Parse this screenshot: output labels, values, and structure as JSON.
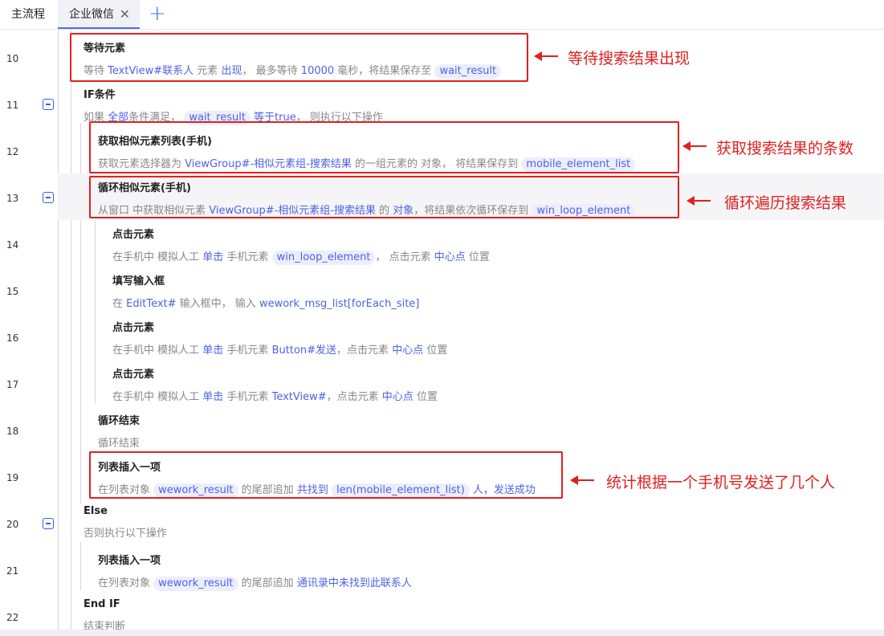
{
  "tabs": {
    "main": "主流程",
    "active": "企业微信",
    "close_icon": "close-icon",
    "add_icon": "plus-icon"
  },
  "lines": {
    "l10": "10",
    "l11": "11",
    "l12": "12",
    "l13": "13",
    "l14": "14",
    "l15": "15",
    "l16": "16",
    "l17": "17",
    "l18": "18",
    "l19": "19",
    "l20": "20",
    "l21": "21",
    "l22": "22"
  },
  "steps": {
    "s10": {
      "title": "等待元素",
      "d1": "等待",
      "d2": "TextView#联系人",
      "d3": "元素",
      "d4": "出现",
      "d5": "，  最多等待",
      "d6": "10000",
      "d7": "毫秒，将结果保存至",
      "d8": "wait_result"
    },
    "s11": {
      "title": "IF条件",
      "d1": "如果",
      "d2": "全部",
      "d3": "条件满足，",
      "d4": "wait_result",
      "d5": "等于true",
      "d6": "，  则执行以下操作"
    },
    "s12": {
      "title": "获取相似元素列表(手机)",
      "d1": "获取元素选择器为",
      "d2": "ViewGroup#-相似元素组-搜索结果",
      "d3": "的一组元素的 对象，  将结果保存到",
      "d4": "mobile_element_list"
    },
    "s13": {
      "title": "循环相似元素(手机)",
      "d1": "从窗口 中获取相似元素",
      "d2": "ViewGroup#-相似元素组-搜索结果",
      "d3": "的",
      "d4": "对象",
      "d5": "，将结果依次循环保存到",
      "d6": "win_loop_element"
    },
    "s14": {
      "title": "点击元素",
      "d1": "在手机中 模拟人工",
      "d2": "单击",
      "d3": "手机元素",
      "d4": "win_loop_element",
      "d5": "，  点击元素",
      "d6": "中心点",
      "d7": "位置"
    },
    "s15": {
      "title": "填写输入框",
      "d1": "在",
      "d2": "EditText#",
      "d3": "输入框中，  输入",
      "d4": "wework_msg_list[forEach_site]"
    },
    "s16": {
      "title": "点击元素",
      "d1": "在手机中 模拟人工",
      "d2": "单击",
      "d3": "手机元素",
      "d4": "Button#发送",
      "d5": "，点击元素",
      "d6": "中心点",
      "d7": "位置"
    },
    "s17": {
      "title": "点击元素",
      "d1": "在手机中 模拟人工",
      "d2": "单击",
      "d3": "手机元素",
      "d4": "TextView#",
      "d5": "，点击元素",
      "d6": "中心点",
      "d7": "位置"
    },
    "s18": {
      "title": "循环结束",
      "d1": "循环结束"
    },
    "s19": {
      "title": "列表插入一项",
      "d1": "在列表对象",
      "d2": "wework_result",
      "d3": "的尾部追加",
      "d4": "共找到",
      "d5": "len(mobile_element_list)",
      "d6": "人，发送成功"
    },
    "s20": {
      "title": "Else",
      "d1": "否则执行以下操作"
    },
    "s21": {
      "title": "列表插入一项",
      "d1": "在列表对象",
      "d2": "wework_result",
      "d3": "的尾部追加",
      "d4": "通讯录中未找到此联系人"
    },
    "s22": {
      "title": "End IF",
      "d1": "结束判断"
    }
  },
  "annotations": {
    "a1": "等待搜索结果出现",
    "a2": "获取搜索结果的条数",
    "a3": "循环遍历搜索结果",
    "a4": "统计根据一个手机号发送了几个人"
  },
  "colors": {
    "accent": "#4c62e8",
    "annotation_red": "#e02020"
  }
}
